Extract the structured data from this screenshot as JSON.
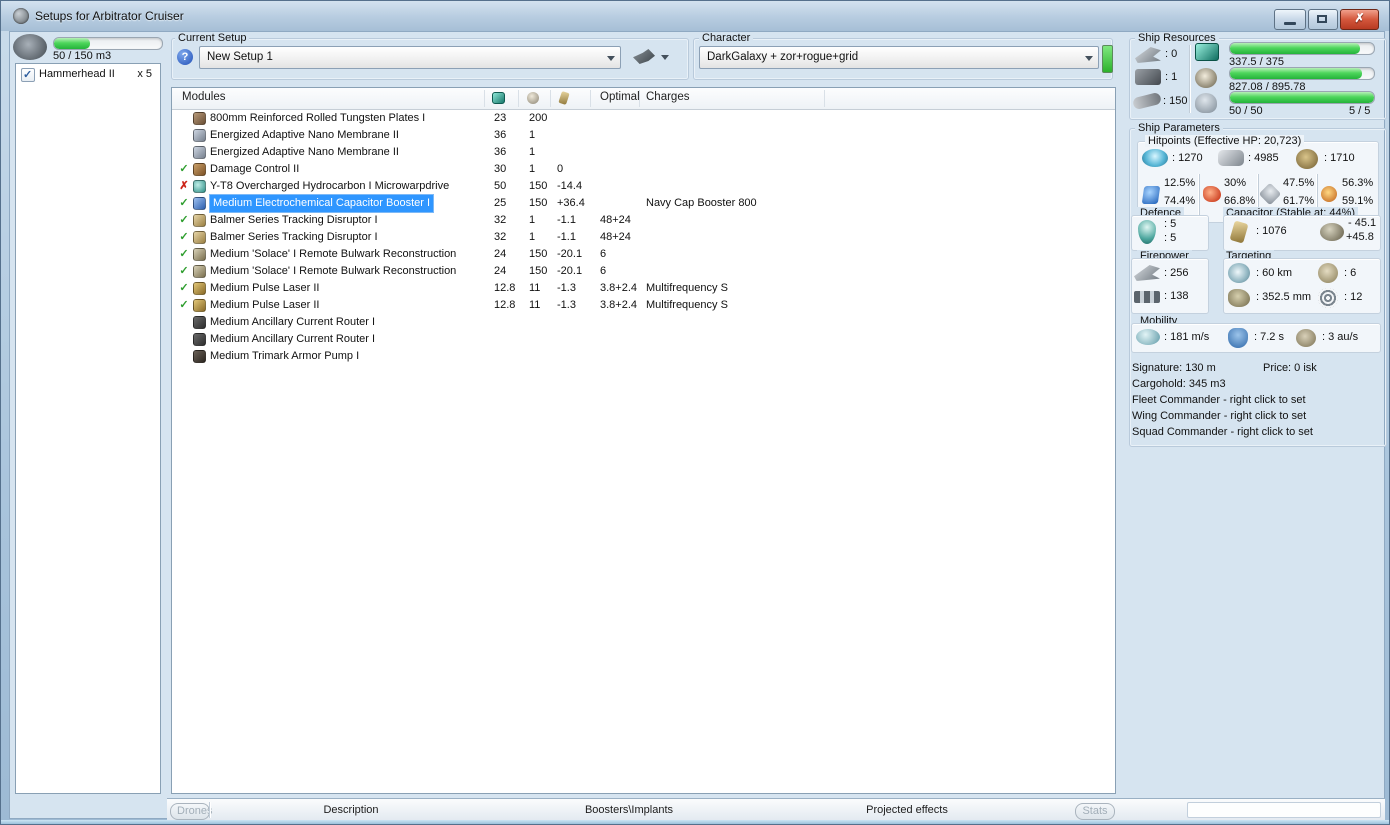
{
  "window": {
    "title": "Setups for Arbitrator Cruiser"
  },
  "drone_bay": {
    "capacity_label": "50 / 150 m3",
    "fill_pct": 33,
    "items": [
      {
        "checked": true,
        "name": "Hammerhead II",
        "qty": "x 5"
      }
    ]
  },
  "current_setup": {
    "label": "Current Setup",
    "value": "New Setup 1",
    "help_glyph": "?"
  },
  "character": {
    "label": "Character",
    "value": "DarkGalaxy + zor+rogue+grid"
  },
  "modules_table": {
    "header": {
      "modules": "Modules",
      "optimal": "Optimal",
      "charges": "Charges"
    },
    "rows": [
      {
        "status": "",
        "icon": "plate",
        "name": "800mm Reinforced Rolled Tungsten Plates I",
        "cpu": "23",
        "pg": "200",
        "cap": "",
        "optimal": "",
        "charges": ""
      },
      {
        "status": "",
        "icon": "membrane",
        "name": "Energized Adaptive Nano Membrane II",
        "cpu": "36",
        "pg": "1",
        "cap": "",
        "optimal": "",
        "charges": ""
      },
      {
        "status": "",
        "icon": "membrane",
        "name": "Energized Adaptive Nano Membrane II",
        "cpu": "36",
        "pg": "1",
        "cap": "",
        "optimal": "",
        "charges": ""
      },
      {
        "status": "ok",
        "icon": "damage-control",
        "name": "Damage Control II",
        "cpu": "30",
        "pg": "1",
        "cap": "0",
        "optimal": "",
        "charges": ""
      },
      {
        "status": "error",
        "icon": "mwd",
        "name": "Y-T8 Overcharged Hydrocarbon I Microwarpdrive",
        "cpu": "50",
        "pg": "150",
        "cap": "-14.4",
        "optimal": "",
        "charges": ""
      },
      {
        "status": "ok",
        "icon": "cap-booster",
        "name": "Medium Electrochemical Capacitor Booster I",
        "cpu": "25",
        "pg": "150",
        "cap": "+36.4",
        "optimal": "",
        "charges": "Navy Cap Booster 800",
        "selected": true
      },
      {
        "status": "ok",
        "icon": "tracking-disruptor",
        "name": "Balmer Series Tracking Disruptor I",
        "cpu": "32",
        "pg": "1",
        "cap": "-1.1",
        "optimal": "48+24",
        "charges": ""
      },
      {
        "status": "ok",
        "icon": "tracking-disruptor",
        "name": "Balmer Series Tracking Disruptor I",
        "cpu": "32",
        "pg": "1",
        "cap": "-1.1",
        "optimal": "48+24",
        "charges": ""
      },
      {
        "status": "ok",
        "icon": "remote-rep",
        "name": "Medium 'Solace' I Remote Bulwark Reconstruction",
        "cpu": "24",
        "pg": "150",
        "cap": "-20.1",
        "optimal": "6",
        "charges": ""
      },
      {
        "status": "ok",
        "icon": "remote-rep",
        "name": "Medium 'Solace' I Remote Bulwark Reconstruction",
        "cpu": "24",
        "pg": "150",
        "cap": "-20.1",
        "optimal": "6",
        "charges": ""
      },
      {
        "status": "ok",
        "icon": "pulse-laser",
        "name": "Medium Pulse Laser II",
        "cpu": "12.8",
        "pg": "11",
        "cap": "-1.3",
        "optimal": "3.8+2.4",
        "charges": "Multifrequency S"
      },
      {
        "status": "ok",
        "icon": "pulse-laser",
        "name": "Medium Pulse Laser II",
        "cpu": "12.8",
        "pg": "11",
        "cap": "-1.3",
        "optimal": "3.8+2.4",
        "charges": "Multifrequency S"
      },
      {
        "status": "",
        "icon": "rig-router",
        "name": "Medium Ancillary Current Router I",
        "cpu": "",
        "pg": "",
        "cap": "",
        "optimal": "",
        "charges": ""
      },
      {
        "status": "",
        "icon": "rig-router",
        "name": "Medium Ancillary Current Router I",
        "cpu": "",
        "pg": "",
        "cap": "",
        "optimal": "",
        "charges": ""
      },
      {
        "status": "",
        "icon": "rig-pump",
        "name": "Medium Trimark Armor Pump I",
        "cpu": "",
        "pg": "",
        "cap": "",
        "optimal": "",
        "charges": ""
      }
    ]
  },
  "ship_resources": {
    "label": "Ship Resources",
    "turrets": ": 0",
    "launchers": ": 1",
    "calibration": ": 150",
    "cpu": {
      "text": "337.5 / 375",
      "pct": 90
    },
    "powergrid": {
      "text": "827.08 / 895.78",
      "pct": 92
    },
    "drones": {
      "text": "50 / 50",
      "bandwidth": "5 / 5",
      "pct": 100
    }
  },
  "ship_parameters": {
    "label": "Ship Parameters",
    "hitpoints": {
      "label": "Hitpoints (Effective HP: 20,723)",
      "shield": ": 1270",
      "armor": ": 4985",
      "hull": ": 1710",
      "resists": [
        {
          "icon": "em-resist-icon",
          "top": "12.5%",
          "bottom": "74.4%"
        },
        {
          "icon": "thermal-resist-icon",
          "top": "30%",
          "bottom": "66.8%"
        },
        {
          "icon": "kinetic-resist-icon",
          "top": "47.5%",
          "bottom": "61.7%"
        },
        {
          "icon": "explosive-resist-icon",
          "top": "56.3%",
          "bottom": "59.1%"
        }
      ]
    },
    "defence": {
      "label": "Defence",
      "line1": ": 5",
      "line2": ": 5"
    },
    "capacitor": {
      "label": "Capacitor (Stable at: 44%)",
      "amount": ": 1076",
      "drain": "- 45.1",
      "recharge": "+45.8"
    },
    "firepower": {
      "label": "Firepower",
      "volley": ": 256",
      "dps": ": 138"
    },
    "targeting": {
      "label": "Targeting",
      "range": ": 60 km",
      "max_targets": ": 6",
      "scan_resolution": ": 352.5 mm",
      "sensor_strength": ": 12"
    },
    "mobility": {
      "label": "Mobility",
      "speed": ": 181 m/s",
      "align_time": ": 7.2 s",
      "warp_speed": ": 3 au/s"
    },
    "info": {
      "signature": "Signature: 130 m",
      "price": "Price: 0 isk",
      "cargohold": "Cargohold: 345 m3",
      "fleet": "Fleet Commander - right click to set",
      "wing": "Wing Commander - right click to set",
      "squad": "Squad Commander - right click to set"
    }
  },
  "bottom_bar": {
    "drones_button": "Drones",
    "stats_button": "Stats",
    "tabs": [
      {
        "label": "Description"
      },
      {
        "label": "Boosters\\Implants"
      },
      {
        "label": "Projected effects"
      }
    ]
  },
  "colors": {
    "selection": "#2f96ff",
    "progress_green": "#23b33a",
    "status_ok": "#2f9e2f",
    "status_error": "#cc2418"
  }
}
